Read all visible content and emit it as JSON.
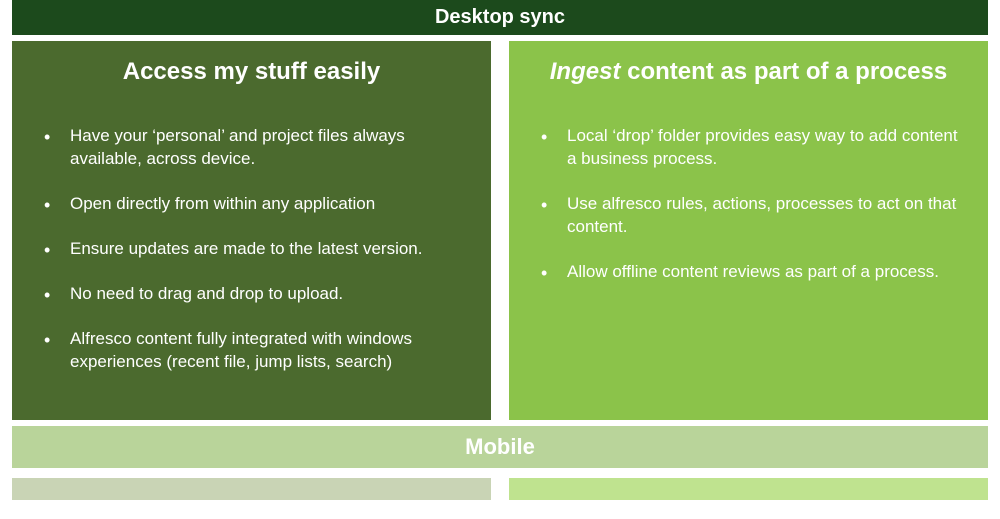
{
  "header": {
    "title": "Desktop sync"
  },
  "left": {
    "heading": "Access my stuff easily",
    "bullets": [
      "Have your ‘personal’ and project files always available, across device.",
      "Open directly from within any application",
      "Ensure updates are made to the latest version.",
      "No need to drag and drop to upload.",
      "Alfresco content fully integrated with windows experiences (recent file, jump lists, search)"
    ]
  },
  "right": {
    "heading_italic": "Ingest",
    "heading_rest": " content as part of a process",
    "bullets": [
      "Local ‘drop’ folder provides easy way to add content a business process.",
      "Use alfresco rules, actions, processes to act on that content.",
      "Allow offline content reviews as part of a process."
    ]
  },
  "footer": {
    "title": "Mobile"
  }
}
